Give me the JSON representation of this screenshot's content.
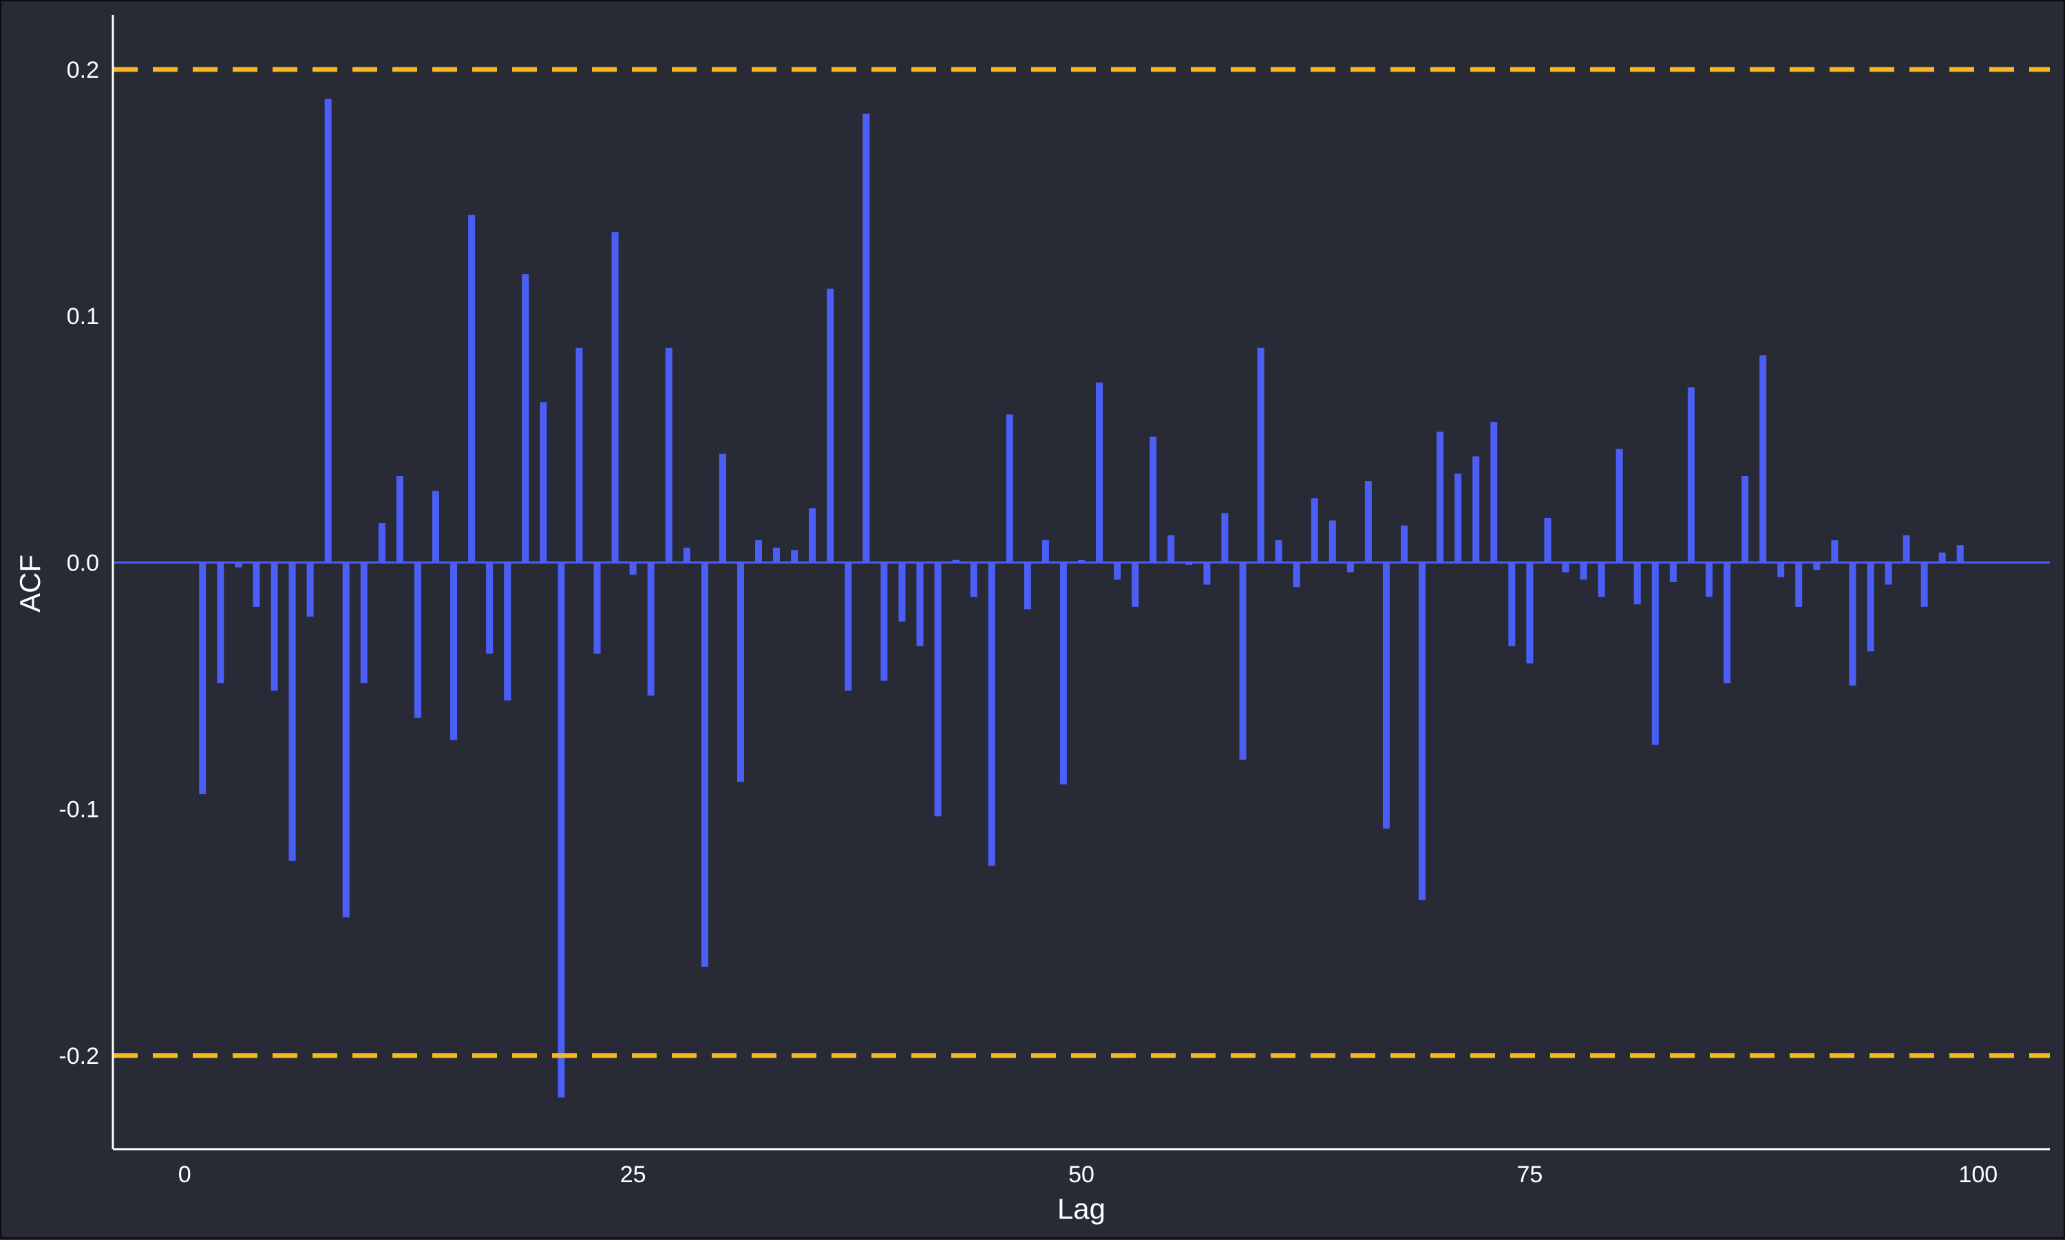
{
  "chart_data": {
    "type": "bar",
    "xlabel": "Lag",
    "ylabel": "ACF",
    "xlim": [
      -4,
      104
    ],
    "ylim": [
      -0.238,
      0.222
    ],
    "x_ticks": [
      0,
      25,
      50,
      75,
      100
    ],
    "x_tick_labels": [
      "0",
      "25",
      "50",
      "75",
      "100"
    ],
    "y_ticks": [
      -0.2,
      -0.1,
      0.0,
      0.1,
      0.2
    ],
    "y_tick_labels": [
      "-0.2",
      "-0.1",
      "0.0",
      "0.1",
      "0.2"
    ],
    "grid": false,
    "confidence_bounds": [
      -0.2,
      0.2
    ],
    "lags": [
      1,
      2,
      3,
      4,
      5,
      6,
      7,
      8,
      9,
      10,
      11,
      12,
      13,
      14,
      15,
      16,
      17,
      18,
      19,
      20,
      21,
      22,
      23,
      24,
      25,
      26,
      27,
      28,
      29,
      30,
      31,
      32,
      33,
      34,
      35,
      36,
      37,
      38,
      39,
      40,
      41,
      42,
      43,
      44,
      45,
      46,
      47,
      48,
      49,
      50,
      51,
      52,
      53,
      54,
      55,
      56,
      57,
      58,
      59,
      60,
      61,
      62,
      63,
      64,
      65,
      66,
      67,
      68,
      69,
      70,
      71,
      72,
      73,
      74,
      75,
      76,
      77,
      78,
      79,
      80,
      81,
      82,
      83,
      84,
      85,
      86,
      87,
      88,
      89,
      90,
      91,
      92,
      93,
      94,
      95,
      96,
      97,
      98,
      99
    ],
    "values": [
      -0.094,
      -0.049,
      -0.002,
      -0.018,
      -0.052,
      -0.121,
      -0.022,
      0.188,
      -0.144,
      -0.049,
      0.016,
      0.035,
      -0.063,
      0.029,
      -0.072,
      0.141,
      -0.037,
      -0.056,
      0.117,
      0.065,
      -0.217,
      0.087,
      -0.037,
      0.134,
      -0.005,
      -0.054,
      0.087,
      0.006,
      -0.164,
      0.044,
      -0.089,
      0.009,
      0.006,
      0.005,
      0.022,
      0.111,
      -0.052,
      0.182,
      -0.048,
      -0.024,
      -0.034,
      -0.103,
      0.001,
      -0.014,
      -0.123,
      0.06,
      -0.019,
      0.009,
      -0.09,
      0.001,
      0.073,
      -0.007,
      -0.018,
      0.051,
      0.011,
      -0.001,
      -0.009,
      0.02,
      -0.08,
      0.087,
      0.009,
      -0.01,
      0.026,
      0.017,
      -0.004,
      0.033,
      -0.108,
      0.015,
      -0.137,
      0.053,
      0.036,
      0.043,
      0.057,
      -0.034,
      -0.041,
      0.018,
      -0.004,
      -0.007,
      -0.014,
      0.046,
      -0.017,
      -0.074,
      -0.008,
      0.071,
      -0.014,
      -0.049,
      0.035,
      0.084,
      -0.006,
      -0.018,
      -0.003,
      0.009,
      -0.05,
      -0.036,
      -0.009,
      0.011,
      -0.018,
      0.004,
      0.007
    ],
    "colors": {
      "background": "#282a36",
      "bars": "#4b5ff6",
      "bounds": "#f8b920",
      "axis": "#ffffff",
      "text": "#ffffff"
    }
  }
}
